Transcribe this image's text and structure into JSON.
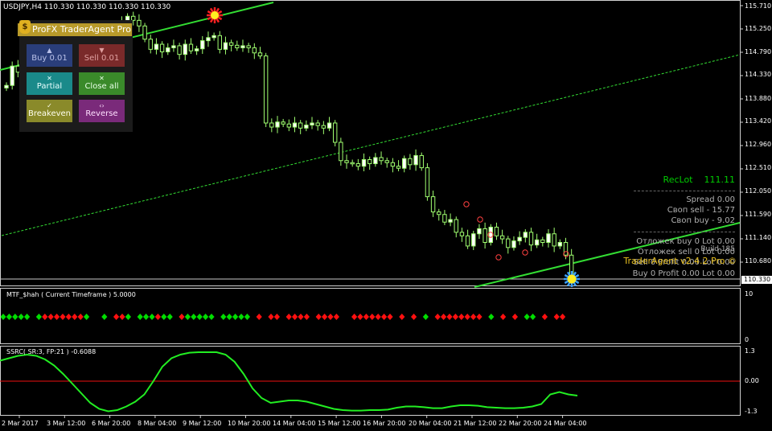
{
  "chart_header": {
    "symbol_info": "USDJPY,H4  110.330 110.330 110.330 110.330"
  },
  "trade_panel": {
    "title": "ProFX TraderAgent Pro",
    "buttons": {
      "buy": "Buy 0.01",
      "sell": "Sell 0.01",
      "partial": "Partial",
      "close_all": "Close all",
      "breakeven": "Breakeven",
      "reverse": "Reverse"
    }
  },
  "info_box": {
    "reclot_label": "RecLot",
    "reclot_value": "111.11",
    "spread": "Spread   0.00",
    "swap_sell": "Своп sell  - 15.77",
    "swap_buy": "Своп buy  - 9.02",
    "pending_buy": "Отложек buy 0   Lot 0.00",
    "pending_sell": "Отложек sell 0   Lot 0.00",
    "build": "Build 185",
    "version": "TraderAgent v2.4.2 Pro ©",
    "sell_line": "Sell 0  Profit 0.00  Lot 0.00",
    "buy_line": "Buy 0  Profit 0.00  Lot 0.00"
  },
  "price_axis": {
    "labels": [
      "115.710",
      "115.250",
      "114.790",
      "114.330",
      "113.880",
      "113.420",
      "112.960",
      "112.510",
      "112.050",
      "111.590",
      "111.140",
      "110.680"
    ],
    "current_price": "110.330"
  },
  "time_axis": {
    "labels": [
      "2 Mar 2017",
      "3 Mar 12:00",
      "6 Mar 20:00",
      "8 Mar 04:00",
      "9 Mar 12:00",
      "10 Mar 20:00",
      "14 Mar 04:00",
      "15 Mar 12:00",
      "16 Mar 20:00",
      "20 Mar 04:00",
      "21 Mar 12:00",
      "22 Mar 20:00",
      "24 Mar 04:00"
    ]
  },
  "subwindows": {
    "mtf": {
      "title": "MTF_$hah ( Current Timeframe )  5.0000",
      "scale_top": "10",
      "scale_bottom": "0"
    },
    "ssrc": {
      "title": "SSRC( SR:3, FP:21 ) -0.6088",
      "scale_top": "1.3",
      "scale_mid": "0.00",
      "scale_bottom": "-1.3"
    }
  },
  "colors": {
    "bull_candle": "#ffffff",
    "bear_candle": "#ffffff",
    "candle_glow": "#a0ff70",
    "channel_solid": "#33dd33",
    "channel_dashed": "#33dd33",
    "diamond_green": "#00dd00",
    "diamond_red": "#ff1010",
    "ssrc_line": "#22ee22",
    "ssrc_zero": "#ee1010",
    "reclot": "#00cc00",
    "info_text": "#b0b0b0",
    "version_text": "#e8c020"
  },
  "chart_data": {
    "type": "candlestick",
    "symbol": "USDJPY",
    "timeframe": "H4",
    "close": [
      114.14,
      114.52,
      114.4,
      114.58,
      114.35,
      114.12,
      113.95,
      114.18,
      114.05,
      114.32,
      114.28,
      114.55,
      114.62,
      114.89,
      114.78,
      114.95,
      115.1,
      114.9,
      115.05,
      115.25,
      115.38,
      115.5,
      115.42,
      115.31,
      115.05,
      114.85,
      114.95,
      114.8,
      114.88,
      114.92,
      114.75,
      114.95,
      114.82,
      114.86,
      115.02,
      115.08,
      115.12,
      114.85,
      114.98,
      114.93,
      114.88,
      114.92,
      114.88,
      114.78,
      114.72,
      113.4,
      113.32,
      113.42,
      113.38,
      113.32,
      113.4,
      113.3,
      113.36,
      113.4,
      113.35,
      113.3,
      113.4,
      113.02,
      112.66,
      112.62,
      112.6,
      112.55,
      112.68,
      112.6,
      112.72,
      112.66,
      112.62,
      112.55,
      112.51,
      112.7,
      112.58,
      112.76,
      112.52,
      111.95,
      111.65,
      111.6,
      111.45,
      111.5,
      111.25,
      111.18,
      110.98,
      111.22,
      111.32,
      111.05,
      111.35,
      111.18,
      111.12,
      110.95,
      111.08,
      111.15,
      111.25,
      111.0,
      111.1,
      111.05,
      111.22,
      110.98,
      111.05,
      110.8,
      110.33
    ],
    "mtf_signals": [
      "green",
      "green",
      "green",
      "green",
      "green",
      "none",
      "green",
      "red",
      "red",
      "red",
      "red",
      "red",
      "red",
      "red",
      "green",
      "none",
      "none",
      "green",
      "none",
      "red",
      "red",
      "green",
      "none",
      "green",
      "green",
      "green",
      "red",
      "green",
      "green",
      "none",
      "red",
      "green",
      "green",
      "green",
      "green",
      "green",
      "none",
      "green",
      "green",
      "green",
      "green",
      "green",
      "none",
      "red",
      "none",
      "red",
      "red",
      "none",
      "red",
      "red",
      "red",
      "red",
      "none",
      "red",
      "red",
      "red",
      "red",
      "none",
      "none",
      "red",
      "red",
      "red",
      "red",
      "red",
      "red",
      "red",
      "none",
      "red",
      "none",
      "red",
      "none",
      "green",
      "none",
      "red",
      "red",
      "red",
      "red",
      "red",
      "red",
      "red",
      "red",
      "none",
      "green",
      "none",
      "red",
      "none",
      "red",
      "none",
      "green",
      "green",
      "none",
      "red",
      "none",
      "red",
      "red"
    ],
    "ssrc": [
      0.85,
      0.95,
      1.05,
      1.1,
      1.05,
      0.9,
      0.65,
      0.3,
      -0.1,
      -0.5,
      -0.9,
      -1.15,
      -1.25,
      -1.2,
      -1.05,
      -0.85,
      -0.55,
      0.0,
      0.6,
      0.95,
      1.1,
      1.18,
      1.2,
      1.2,
      1.2,
      1.1,
      0.8,
      0.3,
      -0.3,
      -0.7,
      -0.9,
      -0.85,
      -0.8,
      -0.8,
      -0.85,
      -0.95,
      -1.05,
      -1.15,
      -1.2,
      -1.22,
      -1.22,
      -1.2,
      -1.2,
      -1.18,
      -1.1,
      -1.05,
      -1.05,
      -1.08,
      -1.12,
      -1.12,
      -1.05,
      -1.0,
      -1.0,
      -1.02,
      -1.08,
      -1.1,
      -1.12,
      -1.12,
      -1.1,
      -1.05,
      -0.95,
      -0.55,
      -0.45,
      -0.55,
      -0.6
    ],
    "ylim": [
      110.33,
      115.71
    ]
  }
}
